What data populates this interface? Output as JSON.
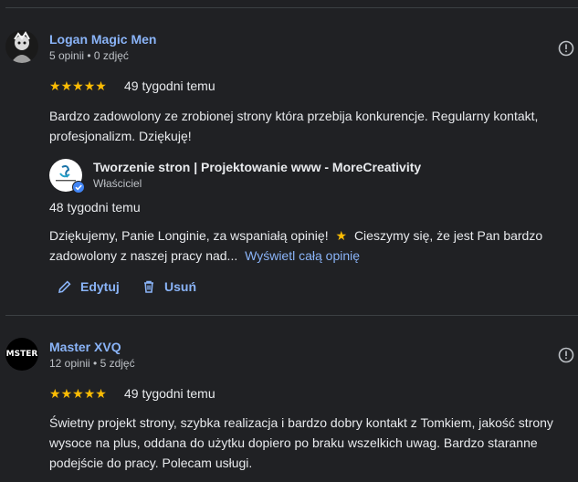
{
  "review1": {
    "author": "Logan Magic Men",
    "meta": "5 opinii • 0 zdjęć",
    "rating": 5,
    "time": "49 tygodni temu",
    "text_line1": "Bardzo zadowolony ze zrobionej strony która przebija konkurencje. Regularny kontakt,",
    "text_line2": "profesjonalizm. Dziękuję!",
    "owner": {
      "name": "Tworzenie stron | Projektowanie www - MoreCreativity",
      "role": "Właściciel",
      "time": "48 tygodni temu",
      "reply_line1_a": "Dziękujemy, Panie Longinie, za wspaniałą opinię!",
      "reply_line1_b": "Cieszymy się, że jest Pan bardzo",
      "reply_line2": "zadowolony z naszej pracy nad...",
      "more_link": "Wyświetl całą opinię"
    },
    "edit_label": "Edytuj",
    "delete_label": "Usuń"
  },
  "review2": {
    "author": "Master XVQ",
    "avatar_text": "MSTER",
    "meta": "12 opinii • 5 zdjęć",
    "rating": 5,
    "time": "49 tygodni temu",
    "text_line1": "Świetny projekt strony, szybka realizacja i bardzo dobry kontakt z Tomkiem, jakość strony",
    "text_line2": "wysoce na plus, oddana do użytku dopiero po braku wszelkich uwag. Bardzo staranne",
    "text_line3": "podejście do pracy. Polecam usługi."
  },
  "colors": {
    "background": "#202124",
    "link": "#8ab4f8",
    "star": "#fbbc04"
  }
}
